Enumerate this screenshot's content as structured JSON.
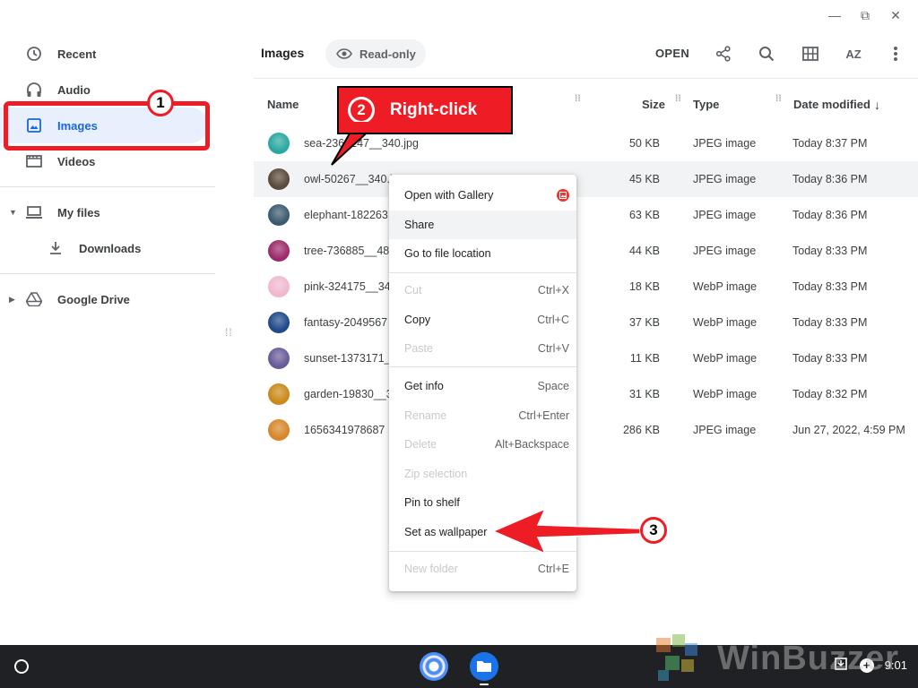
{
  "window": {
    "minimize": "—",
    "restore": "⧉",
    "close": "✕"
  },
  "sidebar": {
    "items": [
      {
        "label": "Recent",
        "icon": "clock-icon"
      },
      {
        "label": "Audio",
        "icon": "headphones-icon"
      },
      {
        "label": "Images",
        "icon": "image-icon",
        "active": true
      },
      {
        "label": "Videos",
        "icon": "video-icon"
      }
    ],
    "my_files": "My files",
    "downloads": "Downloads",
    "google_drive": "Google Drive"
  },
  "toolbar": {
    "breadcrumb": "Images",
    "readonly": "Read-only",
    "open": "OPEN",
    "sort_label": "AZ"
  },
  "table": {
    "headers": {
      "name": "Name",
      "size": "Size",
      "type": "Type",
      "date": "Date modified"
    },
    "rows": [
      {
        "name": "sea-2361247__340.jpg",
        "size": "50 KB",
        "type": "JPEG image",
        "date": "Today 8:37 PM",
        "color": "#2aa7a0"
      },
      {
        "name": "owl-50267__340.j",
        "size": "45 KB",
        "type": "JPEG image",
        "date": "Today 8:36 PM",
        "color": "#5a4a3a"
      },
      {
        "name": "elephant-182263",
        "size": "63 KB",
        "type": "JPEG image",
        "date": "Today 8:36 PM",
        "color": "#3c5a6e"
      },
      {
        "name": "tree-736885__480",
        "size": "44 KB",
        "type": "JPEG image",
        "date": "Today 8:33 PM",
        "color": "#9c2a6a"
      },
      {
        "name": "pink-324175__34",
        "size": "18 KB",
        "type": "WebP image",
        "date": "Today 8:33 PM",
        "color": "#f0b8d0"
      },
      {
        "name": "fantasy-2049567",
        "size": "37 KB",
        "type": "WebP image",
        "date": "Today 8:33 PM",
        "color": "#1f4a8a"
      },
      {
        "name": "sunset-1373171_",
        "size": "11 KB",
        "type": "WebP image",
        "date": "Today 8:33 PM",
        "color": "#6a5a9a"
      },
      {
        "name": "garden-19830__3",
        "size": "31 KB",
        "type": "WebP image",
        "date": "Today 8:32 PM",
        "color": "#c98a1a"
      },
      {
        "name": "1656341978687",
        "size": "286 KB",
        "type": "JPEG image",
        "date": "Jun 27, 2022, 4:59 PM",
        "color": "#d8862a"
      }
    ]
  },
  "context_menu": {
    "open_with_gallery": "Open with Gallery",
    "share": "Share",
    "go_to_file_location": "Go to file location",
    "cut": "Cut",
    "cut_kb": "Ctrl+X",
    "copy": "Copy",
    "copy_kb": "Ctrl+C",
    "paste": "Paste",
    "paste_kb": "Ctrl+V",
    "get_info": "Get info",
    "get_info_kb": "Space",
    "rename": "Rename",
    "rename_kb": "Ctrl+Enter",
    "delete": "Delete",
    "delete_kb": "Alt+Backspace",
    "zip_selection": "Zip selection",
    "pin_to_shelf": "Pin to shelf",
    "set_as_wallpaper": "Set as wallpaper",
    "new_folder": "New folder",
    "new_folder_kb": "Ctrl+E"
  },
  "annotations": {
    "step1": "1",
    "step2": "2",
    "step2_text": "Right-click",
    "step3": "3",
    "accent": "#ee1c25"
  },
  "taskbar": {
    "time": "9:01",
    "watermark": "WinBuzzer"
  }
}
